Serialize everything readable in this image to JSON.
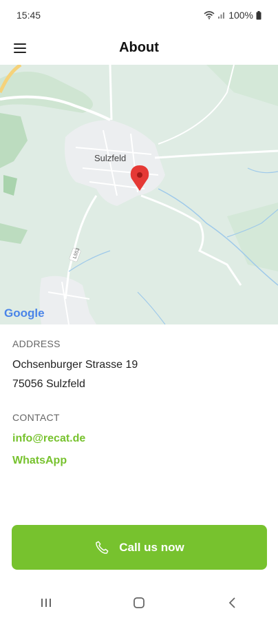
{
  "status": {
    "time": "15:45",
    "battery": "100%"
  },
  "header": {
    "title": "About",
    "menu_icon": "hamburger-menu-icon"
  },
  "map": {
    "town_label": "Sulzfeld",
    "road_label": "L553",
    "attribution": "Google",
    "marker_color": "#e53935"
  },
  "address": {
    "label": "ADDRESS",
    "line1": "Ochsenburger Strasse 19",
    "line2": "75056 Sulzfeld"
  },
  "contact": {
    "label": "CONTACT",
    "email": "info@recat.de",
    "whatsapp": "WhatsApp"
  },
  "call_button": {
    "label": "Call us now",
    "icon": "phone-icon"
  },
  "colors": {
    "accent": "#77c22e"
  }
}
